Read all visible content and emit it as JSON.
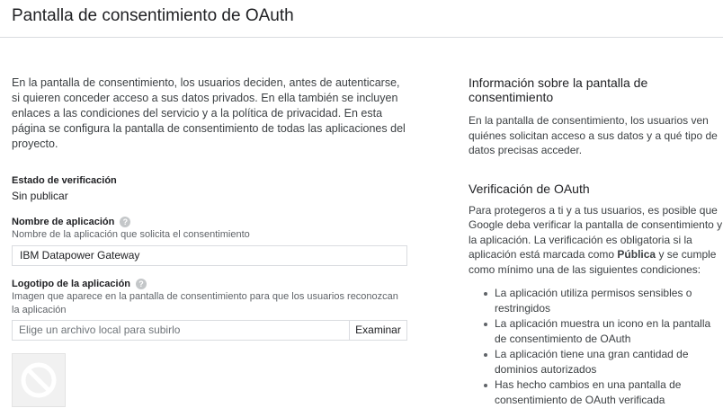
{
  "header": {
    "title": "Pantalla de consentimiento de OAuth"
  },
  "intro": "En la pantalla de consentimiento, los usuarios deciden, antes de autenticarse, si quieren conceder acceso a sus datos privados. En ella también se incluyen enlaces a las condiciones del servicio y a la política de privacidad. En esta página se configura la pantalla de consentimiento de todas las aplicaciones del proyecto.",
  "verification": {
    "label": "Estado de verificación",
    "value": "Sin publicar"
  },
  "app_name": {
    "label": "Nombre de aplicación",
    "hint": "Nombre de la aplicación que solicita el consentimiento",
    "value": "IBM Datapower Gateway"
  },
  "app_logo": {
    "label": "Logotipo de la aplicación",
    "hint": "Imagen que aparece en la pantalla de consentimiento para que los usuarios reconozcan la aplicación",
    "placeholder": "Elige un archivo local para subirlo",
    "browse_label": "Examinar"
  },
  "sidebar": {
    "info_heading": "Información sobre la pantalla de consentimiento",
    "info_text": "En la pantalla de consentimiento, los usuarios ven quiénes solicitan acceso a sus datos y a qué tipo de datos precisas acceder.",
    "oauth_heading": "Verificación de OAuth",
    "oauth_text_before": "Para protegeros a ti y a tus usuarios, es posible que Google deba verificar la pantalla de consentimiento y la aplicación. La verificación es obligatoria si la aplicación está marcada como ",
    "oauth_text_bold": "Pública",
    "oauth_text_after": " y se cumple como mínimo una de las siguientes condiciones:",
    "conditions": [
      "La aplicación utiliza permisos sensibles o restringidos",
      "La aplicación muestra un icono en la pantalla de consentimiento de OAuth",
      "La aplicación tiene una gran cantidad de dominios autorizados",
      "Has hecho cambios en una pantalla de consentimiento de OAuth verificada"
    ]
  }
}
